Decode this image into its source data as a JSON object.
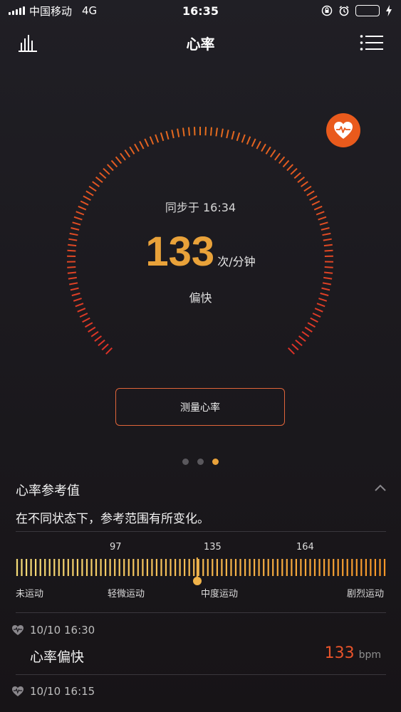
{
  "status_bar": {
    "carrier": "中国移动",
    "network": "4G",
    "time": "16:35"
  },
  "nav": {
    "title": "心率",
    "left_icon": "bar-chart-icon",
    "right_icon": "menu-list-icon"
  },
  "gauge": {
    "sync_text": "同步于 16:34",
    "value": "133",
    "unit": "次/分钟",
    "status": "偏快",
    "badge_icon": "heart-pulse-icon"
  },
  "measure_button": "测量心率",
  "pager": {
    "count": 3,
    "active_index": 2
  },
  "reference": {
    "title": "心率参考值",
    "description": "在不同状态下，参考范围有所变化。",
    "thresholds": [
      "97",
      "135",
      "164"
    ],
    "levels": [
      "未运动",
      "轻微运动",
      "中度运动",
      "剧烈运动"
    ],
    "current_marker_fraction": 0.49
  },
  "records": [
    {
      "time": "10/10 16:30",
      "label": "心率偏快",
      "value": "133",
      "unit": "bpm"
    },
    {
      "time": "10/10 16:15",
      "label": "",
      "value": "",
      "unit": ""
    }
  ],
  "colors": {
    "accent_orange": "#e9a23a",
    "alert_red": "#e8532a",
    "badge_orange": "#e95a1c",
    "tick_yellow": "#f3d36a"
  }
}
